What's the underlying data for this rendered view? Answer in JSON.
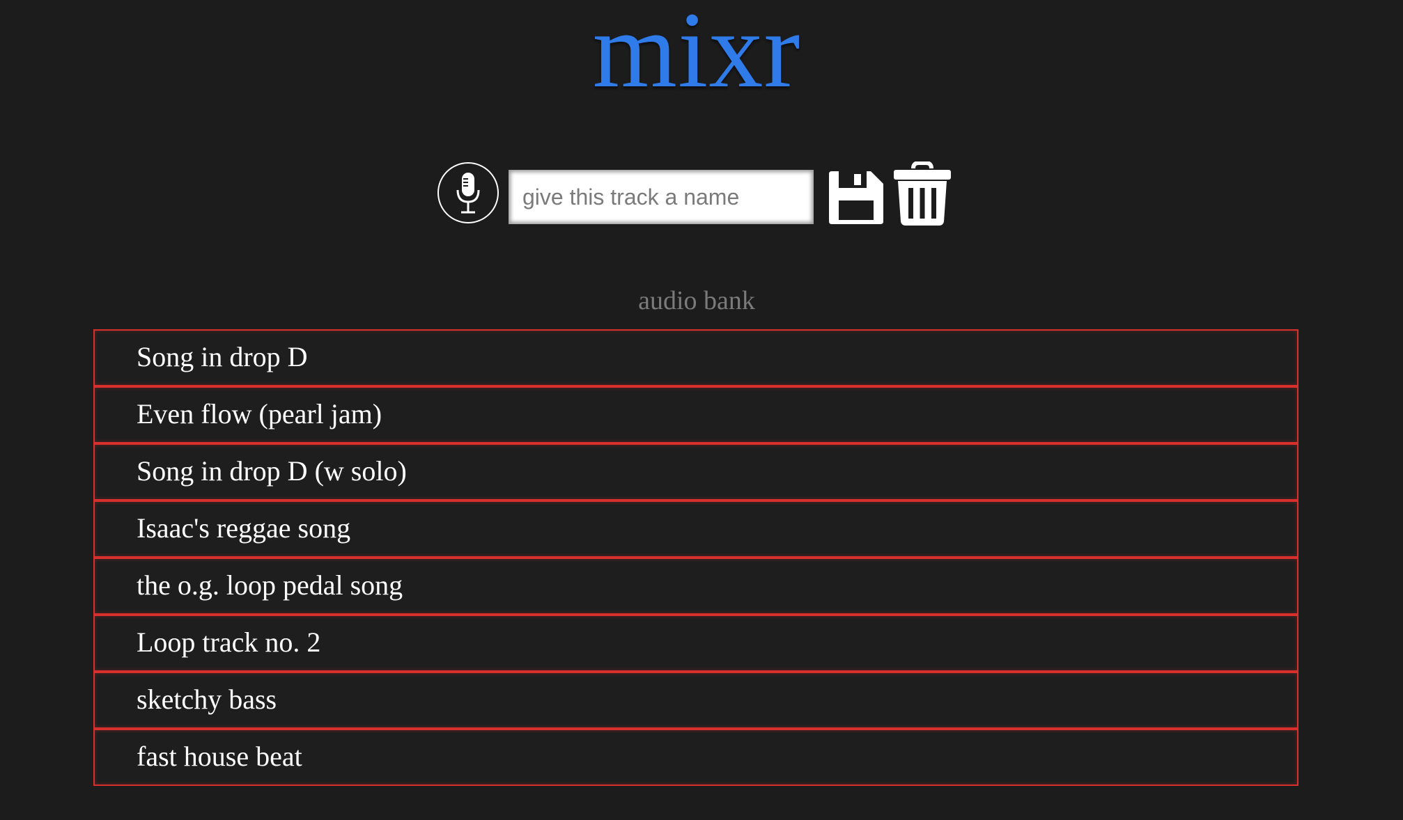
{
  "app": {
    "logo": "mixr",
    "accent_color": "#2f7be9",
    "row_border_color": "#d8302c"
  },
  "toolbar": {
    "record_icon": "microphone-icon",
    "name_placeholder": "give this track a name",
    "name_value": "",
    "save_icon": "floppy-disk-icon",
    "delete_icon": "trash-icon"
  },
  "audio_bank": {
    "title": "audio bank",
    "tracks": [
      {
        "name": "Song in drop D"
      },
      {
        "name": "Even flow (pearl jam)"
      },
      {
        "name": "Song in drop D (w solo)"
      },
      {
        "name": "Isaac's reggae song"
      },
      {
        "name": "the o.g. loop pedal song"
      },
      {
        "name": "Loop track no. 2"
      },
      {
        "name": "sketchy bass"
      },
      {
        "name": "fast house beat"
      }
    ]
  }
}
